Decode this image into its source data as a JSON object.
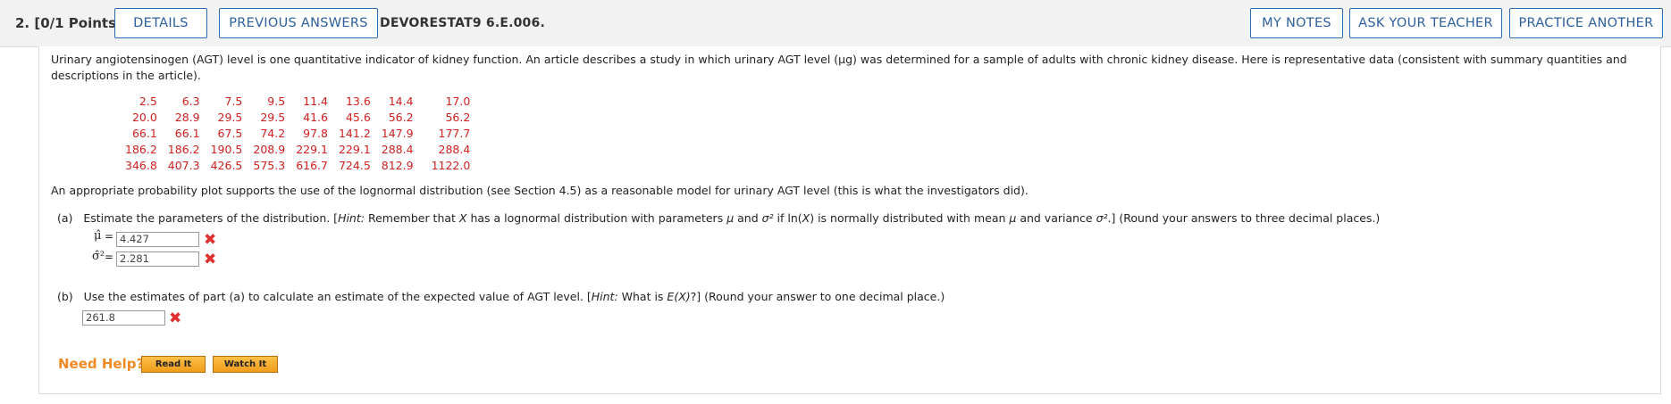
{
  "header": {
    "question_label": "2. [0/1 Points]",
    "details": "DETAILS",
    "previous_answers": "PREVIOUS ANSWERS",
    "question_code": "DEVORESTAT9 6.E.006.",
    "my_notes": "MY NOTES",
    "ask_teacher": "ASK YOUR TEACHER",
    "practice_another": "PRACTICE ANOTHER"
  },
  "intro": "Urinary angiotensinogen (AGT) level is one quantitative indicator of kidney function. An article describes a study in which urinary AGT level (μg) was determined for a sample of adults with chronic kidney disease. Here is representative data (consistent with summary quantities and descriptions in the article).",
  "data_rows": [
    [
      "2.5",
      "6.3",
      "7.5",
      "9.5",
      "11.4",
      "13.6",
      "14.4",
      "17.0"
    ],
    [
      "20.0",
      "28.9",
      "29.5",
      "29.5",
      "41.6",
      "45.6",
      "56.2",
      "56.2"
    ],
    [
      "66.1",
      "66.1",
      "67.5",
      "74.2",
      "97.8",
      "141.2",
      "147.9",
      "177.7"
    ],
    [
      "186.2",
      "186.2",
      "190.5",
      "208.9",
      "229.1",
      "229.1",
      "288.4",
      "288.4"
    ],
    [
      "346.8",
      "407.3",
      "426.5",
      "575.3",
      "616.7",
      "724.5",
      "812.9",
      "1122.0"
    ]
  ],
  "sentence": "An appropriate probability plot supports the use of the lognormal distribution (see Section 4.5) as a reasonable model for urinary AGT level (this is what the investigators did).",
  "part_a": {
    "label": "(a)",
    "text1": "Estimate the parameters of the distribution. [",
    "hint": "Hint:",
    "text2": " Remember that ",
    "x1": "X",
    "text3": " has a lognormal distribution with parameters ",
    "mu": "μ",
    "and": " and ",
    "sigma2": "σ²",
    "text4": " if ln(",
    "x2": "X",
    "text5": ") is normally distributed with mean ",
    "mu2": "μ",
    "text6": " and variance ",
    "sigma2b": "σ²",
    "text7": ".] (Round your answers to three decimal places.)",
    "mu_hat_label": "μ̂",
    "sigma_hat_label": "σ̂²",
    "equals": "=",
    "mu_value": "4.427",
    "sigma_value": "2.281"
  },
  "part_b": {
    "label": "(b)",
    "text1": "Use the estimates of part (a) to calculate an estimate of the expected value of AGT level. [",
    "hint": "Hint:",
    "text2": " What is ",
    "ex": "E(X)",
    "text3": "?] (Round your answer to one decimal place.)",
    "value": "261.8"
  },
  "status": {
    "incorrect_mark": "✖"
  },
  "help": {
    "label": "Need Help?",
    "read_it": "Read It",
    "watch_it": "Watch It"
  }
}
